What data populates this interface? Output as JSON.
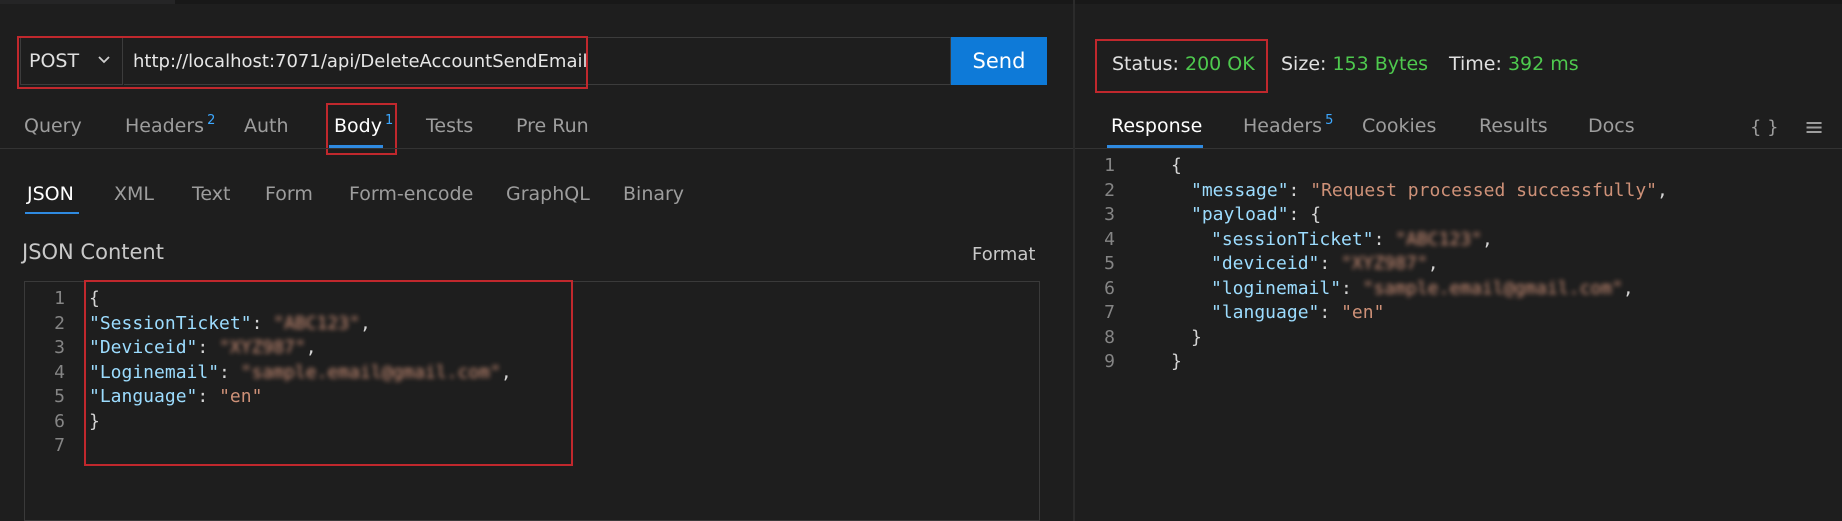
{
  "request": {
    "method": "POST",
    "url": "http://localhost:7071/api/DeleteAccountSendEmail",
    "send_label": "Send",
    "tabs": [
      {
        "label": "Query"
      },
      {
        "label": "Headers",
        "badge": "2"
      },
      {
        "label": "Auth"
      },
      {
        "label": "Body",
        "badge": "1"
      },
      {
        "label": "Tests"
      },
      {
        "label": "Pre Run"
      }
    ],
    "active_tab": "Body",
    "body_types": [
      "JSON",
      "XML",
      "Text",
      "Form",
      "Form-encode",
      "GraphQL",
      "Binary"
    ],
    "active_body_type": "JSON",
    "content_title": "JSON Content",
    "format_label": "Format",
    "body_lines": [
      {
        "n": "1",
        "text": "{"
      },
      {
        "n": "2",
        "key": "\"SessionTicket\"",
        "sep": ": ",
        "val": "\"ABC123\"",
        "end": ","
      },
      {
        "n": "3",
        "key": "\"Deviceid\"",
        "sep": ": ",
        "val": "\"XYZ987\"",
        "end": ","
      },
      {
        "n": "4",
        "key": "\"Loginemail\"",
        "sep": ": ",
        "val": "\"sample.email@gmail.com\"",
        "end": ","
      },
      {
        "n": "5",
        "key": "\"Language\"",
        "sep": ": ",
        "val": "\"en\"",
        "end": ""
      },
      {
        "n": "6",
        "text": "}"
      },
      {
        "n": "7",
        "text": ""
      }
    ]
  },
  "response": {
    "status_label": "Status:",
    "status_value": "200 OK",
    "size_label": "Size:",
    "size_value": "153 Bytes",
    "time_label": "Time:",
    "time_value": "392 ms",
    "tabs": [
      {
        "label": "Response"
      },
      {
        "label": "Headers",
        "badge": "5"
      },
      {
        "label": "Cookies"
      },
      {
        "label": "Results"
      },
      {
        "label": "Docs"
      }
    ],
    "active_tab": "Response",
    "icons": {
      "braces": "{ }",
      "menu": "≡"
    },
    "body_lines": [
      {
        "n": "1",
        "text": "{"
      },
      {
        "n": "2",
        "indent": 1,
        "key": "\"message\"",
        "sep": ": ",
        "val": "\"Request processed successfully\"",
        "end": ","
      },
      {
        "n": "3",
        "indent": 1,
        "key": "\"payload\"",
        "sep": ": ",
        "val": "",
        "end": "{"
      },
      {
        "n": "4",
        "indent": 2,
        "key": "\"sessionTicket\"",
        "sep": ": ",
        "val": "\"ABC123\"",
        "end": ","
      },
      {
        "n": "5",
        "indent": 2,
        "key": "\"deviceid\"",
        "sep": ": ",
        "val": "\"XYZ987\"",
        "end": ","
      },
      {
        "n": "6",
        "indent": 2,
        "key": "\"loginemail\"",
        "sep": ": ",
        "val": "\"sample.email@gmail.com\"",
        "end": ","
      },
      {
        "n": "7",
        "indent": 2,
        "key": "\"language\"",
        "sep": ": ",
        "val": "\"en\"",
        "end": ""
      },
      {
        "n": "8",
        "indent": 1,
        "text": "}"
      },
      {
        "n": "9",
        "text": "}"
      }
    ]
  },
  "colors": {
    "accent": "#0e7ad8",
    "success": "#4ec94e",
    "highlight": "#c0282d"
  }
}
